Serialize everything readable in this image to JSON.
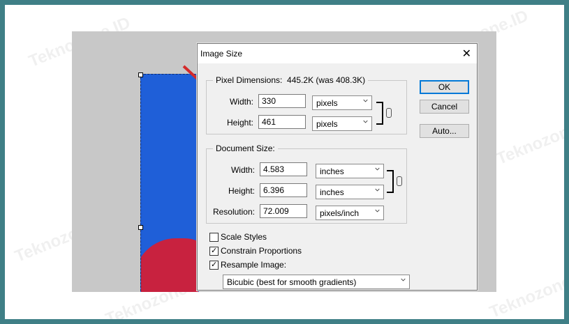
{
  "watermark": "Teknozone.ID",
  "dialog": {
    "title": "Image Size",
    "pixel_dimensions": {
      "label": "Pixel Dimensions:",
      "size": "445.2K (was 408.3K)",
      "width": {
        "label": "Width:",
        "value": "330",
        "unit": "pixels"
      },
      "height": {
        "label": "Height:",
        "value": "461",
        "unit": "pixels"
      }
    },
    "document_size": {
      "label": "Document Size:",
      "width": {
        "label": "Width:",
        "value": "4.583",
        "unit": "inches"
      },
      "height": {
        "label": "Height:",
        "value": "6.396",
        "unit": "inches"
      },
      "resolution": {
        "label": "Resolution:",
        "value": "72.009",
        "unit": "pixels/inch"
      }
    },
    "checkboxes": {
      "scale_styles": {
        "label": "Scale Styles",
        "checked": false
      },
      "constrain": {
        "label": "Constrain Proportions",
        "checked": true
      },
      "resample": {
        "label": "Resample Image:",
        "checked": true
      }
    },
    "resample_method": "Bicubic (best for smooth gradients)",
    "buttons": {
      "ok": "OK",
      "cancel": "Cancel",
      "auto": "Auto..."
    }
  },
  "colors": {
    "border": "#3f7f86",
    "photo_blue": "#1f5fd8",
    "shirt_red": "#c8223f",
    "arrow": "#d42a2a"
  }
}
